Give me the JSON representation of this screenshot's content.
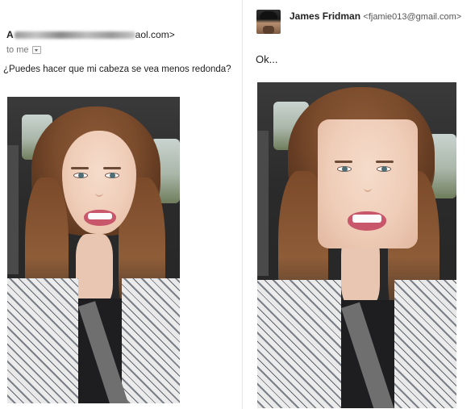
{
  "left_email": {
    "sender_initial": "A",
    "sender_domain": "aol.com>",
    "recipient_label": "to me",
    "body": "¿Puedes hacer que mi cabeza se vea menos redonda?"
  },
  "right_email": {
    "sender_name": "James Fridman",
    "sender_email": "<fjamie013@gmail.com>",
    "body": "Ok..."
  }
}
